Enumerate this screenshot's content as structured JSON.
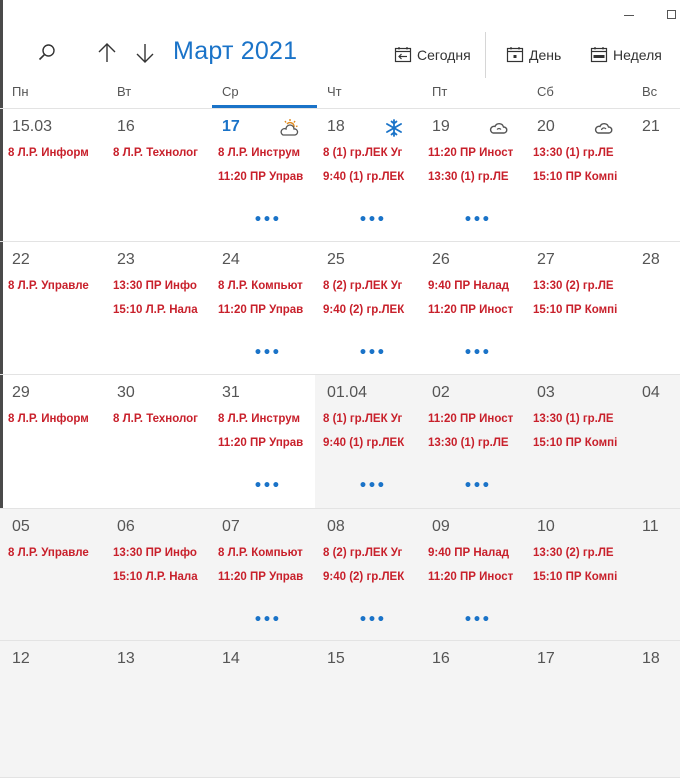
{
  "toolbar": {
    "title": "Март 2021",
    "today_label": "Сегодня",
    "day_label": "День",
    "week_label": "Неделя"
  },
  "weekdays": [
    "Пн",
    "Вт",
    "Ср",
    "Чт",
    "Пт",
    "Сб",
    "Вс"
  ],
  "more_label": "•••",
  "weeks": [
    {
      "days": [
        {
          "num": "15.03",
          "other": false,
          "events": [
            "8 Л.Р. Информ"
          ]
        },
        {
          "num": "16",
          "other": false,
          "events": [
            "8 Л.Р. Технолог"
          ]
        },
        {
          "num": "17",
          "other": false,
          "today": true,
          "weather": "partly-sunny-icon",
          "events": [
            "8 Л.Р. Инструм",
            "11:20 ПР Управ"
          ],
          "more": true
        },
        {
          "num": "18",
          "other": false,
          "weather": "snowflake-icon",
          "events": [
            "8  (1) гр.ЛЕК Уг",
            "9:40  (1) гр.ЛЕК"
          ],
          "more": true
        },
        {
          "num": "19",
          "other": false,
          "weather": "cloud-icon",
          "events": [
            "11:20 ПР Иност",
            "13:30  (1) гр.ЛЕ"
          ],
          "more": true
        },
        {
          "num": "20",
          "other": false,
          "weather": "cloudy-icon",
          "events": [
            "13:30  (1) гр.ЛЕ",
            "15:10 ПР Компі"
          ]
        },
        {
          "num": "21",
          "other": false,
          "events": []
        }
      ]
    },
    {
      "days": [
        {
          "num": "22",
          "other": false,
          "events": [
            "8 Л.Р. Управле"
          ]
        },
        {
          "num": "23",
          "other": false,
          "events": [
            "13:30 ПР Инфо",
            "15:10 Л.Р. Нала"
          ]
        },
        {
          "num": "24",
          "other": false,
          "events": [
            "8 Л.Р. Компьют",
            "11:20 ПР Управ"
          ],
          "more": true
        },
        {
          "num": "25",
          "other": false,
          "events": [
            "8  (2) гр.ЛЕК Уг",
            "9:40  (2) гр.ЛЕК"
          ],
          "more": true
        },
        {
          "num": "26",
          "other": false,
          "events": [
            "9:40 ПР Налад",
            "11:20 ПР Иност"
          ],
          "more": true
        },
        {
          "num": "27",
          "other": false,
          "events": [
            "13:30  (2) гр.ЛЕ",
            "15:10 ПР Компі"
          ]
        },
        {
          "num": "28",
          "other": false,
          "events": []
        }
      ]
    },
    {
      "days": [
        {
          "num": "29",
          "other": false,
          "events": [
            "8 Л.Р. Информ"
          ]
        },
        {
          "num": "30",
          "other": false,
          "events": [
            "8 Л.Р. Технолог"
          ]
        },
        {
          "num": "31",
          "other": false,
          "events": [
            "8 Л.Р. Инструм",
            "11:20 ПР Управ"
          ],
          "more": true
        },
        {
          "num": "01.04",
          "other": true,
          "events": [
            "8  (1) гр.ЛЕК Уг",
            "9:40  (1) гр.ЛЕК"
          ],
          "more": true
        },
        {
          "num": "02",
          "other": true,
          "events": [
            "11:20 ПР Иност",
            "13:30  (1) гр.ЛЕ"
          ],
          "more": true
        },
        {
          "num": "03",
          "other": true,
          "events": [
            "13:30  (1) гр.ЛЕ",
            "15:10 ПР Компі"
          ]
        },
        {
          "num": "04",
          "other": true,
          "events": []
        }
      ]
    },
    {
      "days": [
        {
          "num": "05",
          "other": true,
          "events": [
            "8 Л.Р. Управле"
          ]
        },
        {
          "num": "06",
          "other": true,
          "events": [
            "13:30 ПР Инфо",
            "15:10 Л.Р. Нала"
          ]
        },
        {
          "num": "07",
          "other": true,
          "events": [
            "8 Л.Р. Компьют",
            "11:20 ПР Управ"
          ],
          "more": true
        },
        {
          "num": "08",
          "other": true,
          "events": [
            "8  (2) гр.ЛЕК Уг",
            "9:40  (2) гр.ЛЕК"
          ],
          "more": true
        },
        {
          "num": "09",
          "other": true,
          "events": [
            "9:40 ПР Налад",
            "11:20 ПР Иност"
          ],
          "more": true
        },
        {
          "num": "10",
          "other": true,
          "events": [
            "13:30  (2) гр.ЛЕ",
            "15:10 ПР Компі"
          ]
        },
        {
          "num": "11",
          "other": true,
          "events": []
        }
      ]
    },
    {
      "days": [
        {
          "num": "12",
          "other": true,
          "events": []
        },
        {
          "num": "13",
          "other": true,
          "events": []
        },
        {
          "num": "14",
          "other": true,
          "events": []
        },
        {
          "num": "15",
          "other": true,
          "events": []
        },
        {
          "num": "16",
          "other": true,
          "events": []
        },
        {
          "num": "17",
          "other": true,
          "events": []
        },
        {
          "num": "18",
          "other": true,
          "events": []
        }
      ]
    }
  ]
}
